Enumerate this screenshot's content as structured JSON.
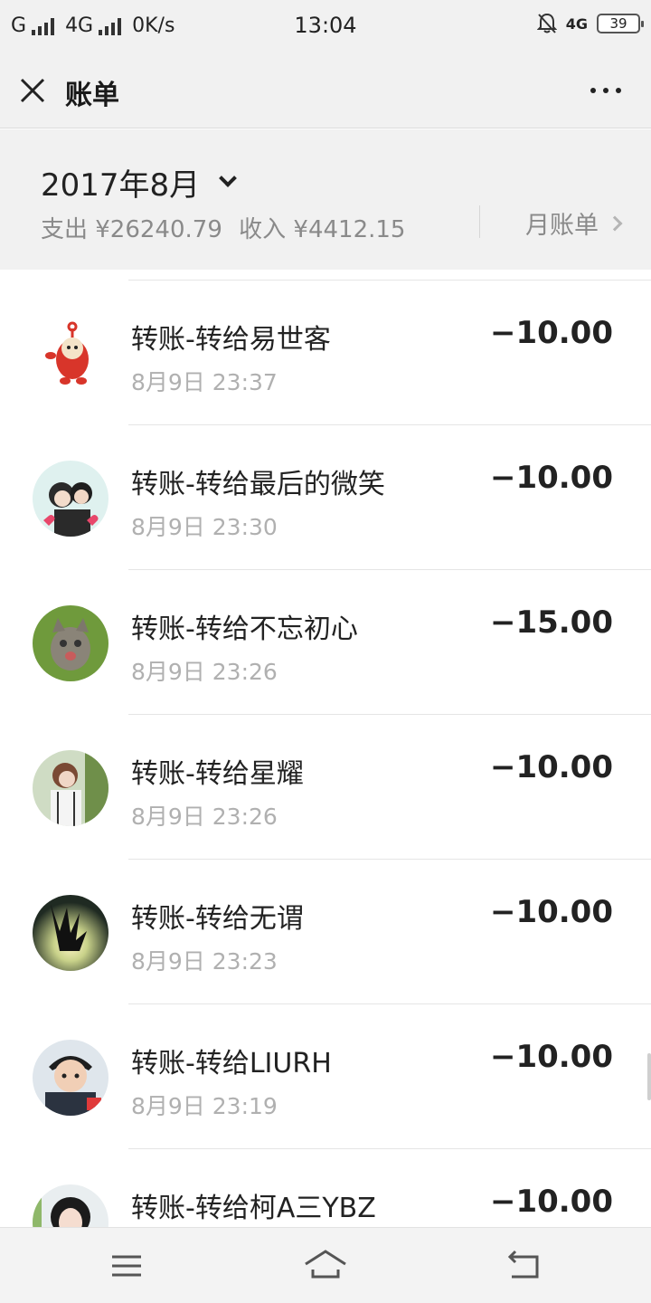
{
  "status_bar": {
    "carrier1": "G",
    "carrier2": "4G",
    "net_speed": "0K/s",
    "time": "13:04",
    "net_type": "4G",
    "battery": "39"
  },
  "header": {
    "title": "账单"
  },
  "summary": {
    "month": "2017年8月",
    "expense": "支出 ¥26240.79",
    "income": "收入 ¥4412.15",
    "monthly_bill": "月账单"
  },
  "transactions": [
    {
      "title": "转账-转给易世客",
      "time": "8月9日 23:37",
      "amount": "−10.00",
      "avatar_icon": "red-cartoon-avatar"
    },
    {
      "title": "转账-转给最后的微笑",
      "time": "8月9日 23:30",
      "amount": "−10.00",
      "avatar_icon": "couple-avatar"
    },
    {
      "title": "转账-转给不忘初心",
      "time": "8月9日 23:26",
      "amount": "−15.00",
      "avatar_icon": "kitten-avatar"
    },
    {
      "title": "转账-转给星耀",
      "time": "8月9日 23:26",
      "amount": "−10.00",
      "avatar_icon": "girl-avatar"
    },
    {
      "title": "转账-转给无谓",
      "time": "8月9日 23:23",
      "amount": "−10.00",
      "avatar_icon": "sunset-hand-avatar"
    },
    {
      "title": "转账-转给LIURH",
      "time": "8月9日 23:19",
      "amount": "−10.00",
      "avatar_icon": "cartoon-boy-avatar"
    },
    {
      "title": "转账-转给柯A三YBZ",
      "time": "",
      "amount": "−10.00",
      "avatar_icon": "woman-avatar"
    }
  ],
  "colors": {
    "background": "#ffffff",
    "header_bg": "#f1f1f1",
    "secondary_text": "#8a8a8a",
    "time_text": "#b0b0b0"
  }
}
